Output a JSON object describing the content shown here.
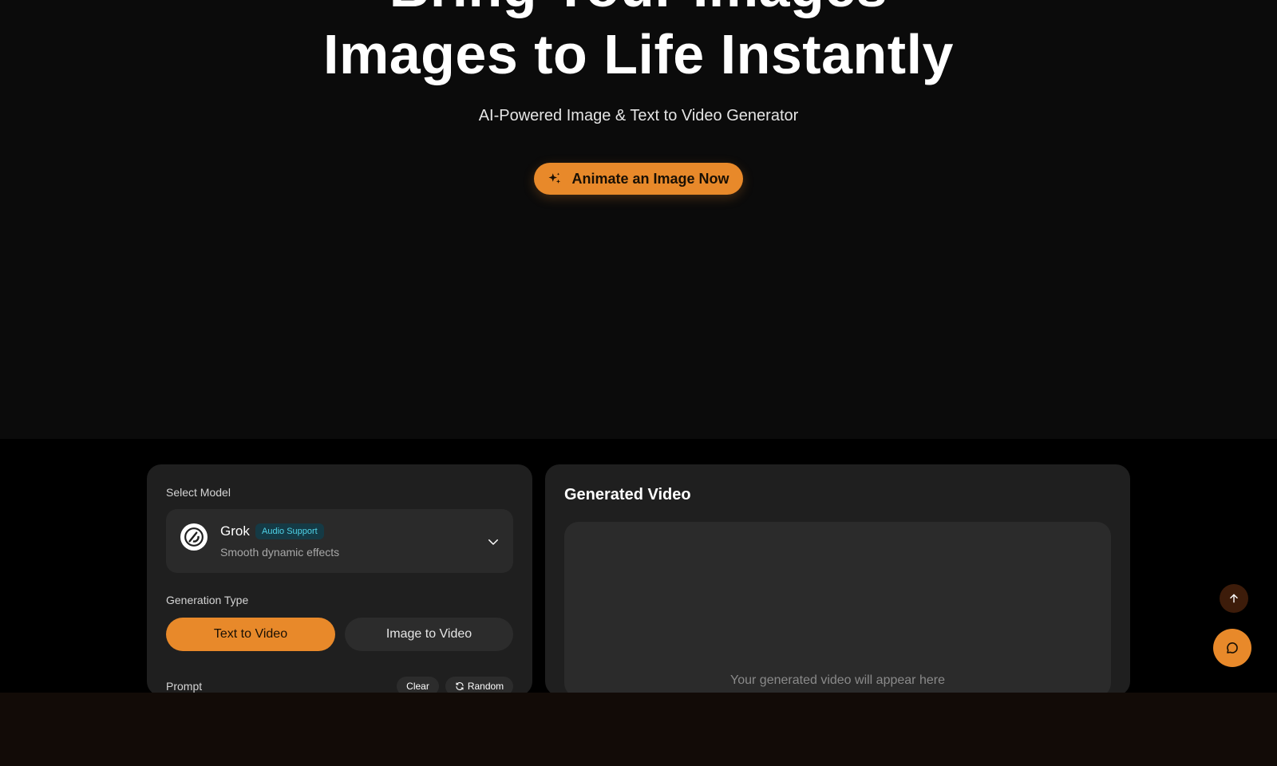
{
  "hero": {
    "title_line1": "Bring Your Images",
    "title_line2": "Images to Life Instantly",
    "subtitle": "AI-Powered Image & Text to Video Generator",
    "cta_label": "Animate an Image Now",
    "cta_icon": "sparkles-icon"
  },
  "controls": {
    "select_model_label": "Select Model",
    "model": {
      "name": "Grok",
      "badge": "Audio Support",
      "description": "Smooth dynamic effects",
      "icon": "grok-logo-icon"
    },
    "generation_type_label": "Generation Type",
    "generation_types": [
      "Text to Video",
      "Image to Video"
    ],
    "active_type": "Text to Video",
    "prompt_label": "Prompt",
    "clear_label": "Clear",
    "random_label": "Random"
  },
  "output": {
    "title": "Generated Video",
    "placeholder": "Your generated video will appear here"
  },
  "floating": {
    "scroll_top_icon": "arrow-up-icon",
    "chat_icon": "chat-bubble-icon"
  },
  "colors": {
    "accent": "#e8892a",
    "panel": "#1f1f1f",
    "badge_bg": "#153a45",
    "badge_text": "#4fd3e8"
  }
}
